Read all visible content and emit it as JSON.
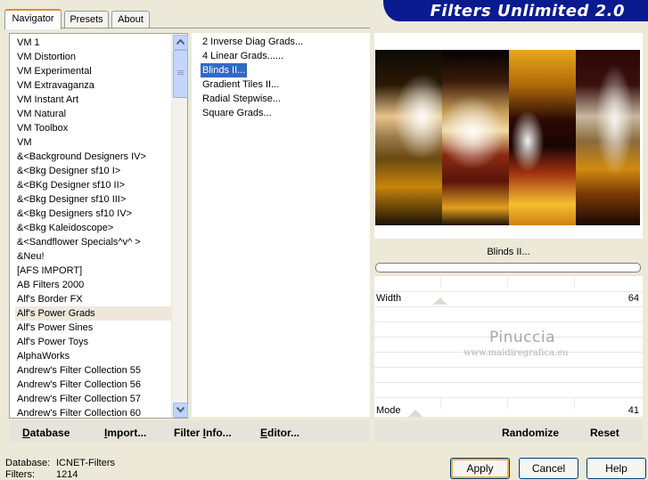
{
  "tabs": [
    {
      "label": "Navigator",
      "active": true
    },
    {
      "label": "Presets",
      "active": false
    },
    {
      "label": "About",
      "active": false
    }
  ],
  "header": {
    "title": "Filters Unlimited 2.0"
  },
  "categories": {
    "items": [
      "VM 1",
      "VM Distortion",
      "VM Experimental",
      "VM Extravaganza",
      "VM Instant Art",
      "VM Natural",
      "VM Toolbox",
      "VM",
      "&<Background Designers IV>",
      "&<Bkg Designer sf10 I>",
      "&<BKg Designer sf10 II>",
      "&<Bkg Designer sf10 III>",
      "&<Bkg Designers sf10 IV>",
      "&<Bkg Kaleidoscope>",
      "&<Sandflower Specials^v^ >",
      "&Neu!",
      "[AFS IMPORT]",
      "AB Filters 2000",
      "Alf's Border FX",
      "Alf's Power Grads",
      "Alf's Power Sines",
      "Alf's Power Toys",
      "AlphaWorks",
      "Andrew's Filter Collection 55",
      "Andrew's Filter Collection 56",
      "Andrew's Filter Collection 57",
      "Andrew's Filter Collection 60"
    ],
    "selected_index": 19
  },
  "filters": {
    "items": [
      "2 Inverse Diag Grads...",
      "4 Linear Grads......",
      "Blinds II...",
      "Gradient Tiles II...",
      "Radial Stepwise...",
      "Square Grads..."
    ],
    "selected_index": 2
  },
  "preview": {
    "filter_name": "Blinds II..."
  },
  "params": [
    {
      "label": "Width",
      "value": "64"
    },
    {
      "label": "Mode",
      "value": "41"
    }
  ],
  "watermark": {
    "name": "Pinuccia",
    "url": "www.maidiregrafica.eu"
  },
  "toolbar": {
    "database": {
      "pre": "",
      "key": "D",
      "post": "atabase"
    },
    "import": {
      "pre": "",
      "key": "I",
      "post": "mport..."
    },
    "filterinfo": {
      "pre": "Filter ",
      "key": "I",
      "post": "nfo..."
    },
    "editor": {
      "pre": "",
      "key": "E",
      "post": "ditor..."
    },
    "randomize": "Randomize",
    "reset": "Reset"
  },
  "status": {
    "database_label": "Database:",
    "database_value": "ICNET-Filters",
    "filters_label": "Filters:",
    "filters_value": "1214"
  },
  "buttons": {
    "apply": "Apply",
    "cancel": "Cancel",
    "help": "Help"
  },
  "colors": {
    "accent": "#316ac5",
    "banner": "#0a1a8f",
    "tab_highlight": "#e68b2c"
  }
}
